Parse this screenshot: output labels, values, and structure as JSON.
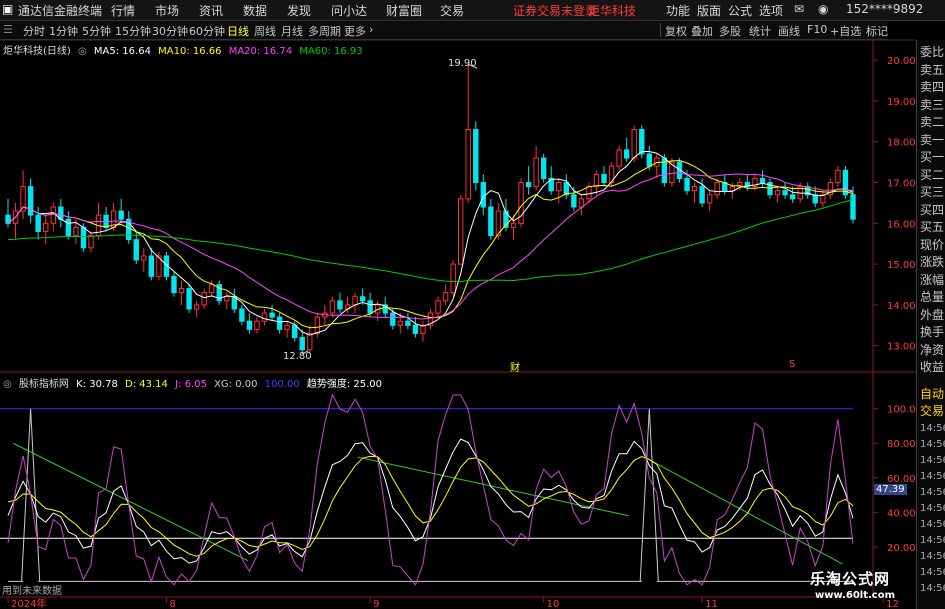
{
  "menubar": {
    "app_title": "通达信金融终端",
    "items": [
      "行情",
      "市场",
      "资讯",
      "数据",
      "发现",
      "问小达",
      "财富圈",
      "交易"
    ],
    "warning": "证券交易未登录",
    "stock_name": "炬华科技",
    "right_items": [
      "功能",
      "版面",
      "公式",
      "选项"
    ],
    "phone": "152****9892"
  },
  "toolbar": {
    "periods": [
      "分时",
      "1分钟",
      "5分钟",
      "15分钟",
      "30分钟",
      "60分钟",
      "日线",
      "周线",
      "月线",
      "多周期",
      "更多"
    ],
    "active_period": "日线",
    "right_buttons": [
      "复权",
      "叠加",
      "多股",
      "统计",
      "画线",
      "F10",
      "+自选",
      "标记"
    ]
  },
  "right_panel": {
    "labels": [
      "委比",
      "卖五",
      "卖四",
      "卖三",
      "卖二",
      "卖一",
      "买一",
      "买二",
      "买三",
      "买四",
      "买五",
      "现价",
      "涨跌",
      "涨幅",
      "总量",
      "外盘",
      "换手",
      "净资",
      "收益"
    ],
    "bottom_labels": [
      "自动",
      "交易"
    ],
    "times": [
      "14:56",
      "14:56",
      "14:56",
      "14:56",
      "14:56",
      "14:56",
      "14:56",
      "14:56",
      "14:56",
      "14:56",
      "14:56"
    ]
  },
  "main_chart": {
    "title": "炬华科技(日线)",
    "ma_labels": [
      {
        "text": "MA5: 16.64",
        "color": "#ffffff"
      },
      {
        "text": "MA10: 16.66",
        "color": "#ffff00"
      },
      {
        "text": "MA20: 16.74",
        "color": "#ff44ff"
      },
      {
        "text": "MA60: 16.93",
        "color": "#00cc00"
      }
    ],
    "high_label": "19.90",
    "low_label": "12.80",
    "marker_cai": "财",
    "marker_s": "S"
  },
  "sub_chart": {
    "title": "股标指标网",
    "values": [
      {
        "text": "K: 30.78",
        "color": "#ffffff"
      },
      {
        "text": "D: 43.14",
        "color": "#ffff00"
      },
      {
        "text": "J: 6.05",
        "color": "#ff44ff"
      },
      {
        "text": "XG: 0.00",
        "color": "#cccccc"
      },
      {
        "text": "100.00",
        "color": "#3344ff"
      }
    ],
    "trend_label": "趋势强度: 25.00",
    "current_value": "47.39",
    "future_note": "用到未来数据"
  },
  "watermark": {
    "line1": "乐淘公式网",
    "line2": "www.60lt.com"
  },
  "chart_data": [
    {
      "type": "candlestick",
      "title": "炬华科技(日线)",
      "y_axis_ticks": [
        13.0,
        14.0,
        15.0,
        16.0,
        17.0,
        18.0,
        19.0,
        20.0
      ],
      "ylim": [
        12.6,
        20.2
      ],
      "grid": false,
      "x_axis_ticks": [
        "2024年",
        "8",
        "9",
        "10",
        "11",
        "12"
      ],
      "ohlc": [
        [
          16.2,
          16.6,
          15.9,
          16.0
        ],
        [
          16.0,
          16.5,
          15.6,
          16.3
        ],
        [
          16.3,
          17.3,
          16.1,
          16.9
        ],
        [
          16.9,
          17.1,
          16.0,
          16.2
        ],
        [
          16.2,
          16.4,
          15.6,
          15.8
        ],
        [
          15.8,
          16.2,
          15.5,
          16.0
        ],
        [
          16.0,
          16.5,
          15.8,
          16.4
        ],
        [
          16.4,
          16.6,
          15.9,
          16.1
        ],
        [
          16.1,
          16.3,
          15.6,
          15.7
        ],
        [
          15.7,
          16.1,
          15.5,
          15.9
        ],
        [
          15.9,
          16.0,
          15.3,
          15.4
        ],
        [
          15.4,
          15.8,
          15.3,
          15.7
        ],
        [
          15.7,
          16.5,
          15.6,
          16.2
        ],
        [
          16.2,
          16.4,
          15.8,
          15.9
        ],
        [
          15.9,
          16.5,
          15.8,
          16.3
        ],
        [
          16.3,
          16.6,
          16.0,
          16.1
        ],
        [
          16.1,
          16.3,
          15.5,
          15.6
        ],
        [
          15.6,
          15.8,
          15.0,
          15.1
        ],
        [
          15.1,
          15.4,
          14.8,
          15.2
        ],
        [
          15.2,
          15.4,
          14.6,
          14.7
        ],
        [
          14.7,
          15.3,
          14.6,
          15.2
        ],
        [
          15.2,
          15.3,
          14.6,
          14.7
        ],
        [
          14.7,
          14.8,
          14.2,
          14.3
        ],
        [
          14.3,
          14.6,
          14.0,
          14.4
        ],
        [
          14.4,
          14.5,
          13.8,
          13.9
        ],
        [
          13.9,
          14.1,
          13.7,
          14.0
        ],
        [
          14.0,
          14.4,
          13.9,
          14.3
        ],
        [
          14.3,
          14.6,
          14.2,
          14.5
        ],
        [
          14.5,
          14.6,
          14.0,
          14.1
        ],
        [
          14.1,
          14.3,
          13.9,
          14.2
        ],
        [
          14.2,
          14.4,
          13.8,
          13.9
        ],
        [
          13.9,
          14.0,
          13.5,
          13.6
        ],
        [
          13.6,
          13.8,
          13.3,
          13.4
        ],
        [
          13.4,
          13.7,
          13.3,
          13.6
        ],
        [
          13.6,
          13.9,
          13.5,
          13.8
        ],
        [
          13.8,
          14.0,
          13.6,
          13.7
        ],
        [
          13.7,
          13.8,
          13.3,
          13.4
        ],
        [
          13.4,
          13.6,
          13.2,
          13.5
        ],
        [
          13.5,
          13.6,
          13.1,
          13.2
        ],
        [
          13.2,
          13.4,
          12.8,
          12.9
        ],
        [
          12.9,
          13.5,
          12.8,
          13.3
        ],
        [
          13.3,
          13.8,
          13.2,
          13.7
        ],
        [
          13.7,
          14.0,
          13.5,
          13.8
        ],
        [
          13.8,
          14.2,
          13.7,
          14.1
        ],
        [
          14.1,
          14.3,
          13.8,
          13.9
        ],
        [
          13.9,
          14.2,
          13.8,
          14.0
        ],
        [
          14.0,
          14.3,
          13.8,
          14.2
        ],
        [
          14.2,
          14.4,
          14.0,
          14.1
        ],
        [
          14.1,
          14.3,
          13.7,
          13.8
        ],
        [
          13.8,
          14.1,
          13.6,
          14.0
        ],
        [
          14.0,
          14.2,
          13.7,
          13.8
        ],
        [
          13.8,
          13.9,
          13.4,
          13.5
        ],
        [
          13.5,
          13.8,
          13.3,
          13.6
        ],
        [
          13.6,
          13.8,
          13.4,
          13.5
        ],
        [
          13.5,
          13.7,
          13.2,
          13.3
        ],
        [
          13.3,
          13.6,
          13.1,
          13.5
        ],
        [
          13.5,
          13.9,
          13.4,
          13.8
        ],
        [
          13.8,
          14.2,
          13.7,
          14.1
        ],
        [
          14.1,
          14.5,
          14.0,
          14.3
        ],
        [
          14.3,
          15.1,
          14.2,
          15.0
        ],
        [
          15.0,
          16.7,
          15.0,
          16.6
        ],
        [
          16.6,
          19.9,
          16.5,
          18.3
        ],
        [
          18.3,
          18.5,
          16.8,
          17.0
        ],
        [
          17.0,
          17.2,
          16.2,
          16.4
        ],
        [
          16.4,
          16.6,
          15.6,
          15.7
        ],
        [
          15.7,
          16.5,
          15.6,
          16.3
        ],
        [
          16.3,
          16.6,
          15.8,
          15.9
        ],
        [
          15.9,
          16.2,
          15.6,
          16.0
        ],
        [
          16.0,
          17.1,
          15.9,
          17.0
        ],
        [
          17.0,
          17.4,
          16.7,
          16.9
        ],
        [
          16.9,
          17.9,
          16.8,
          17.6
        ],
        [
          17.6,
          17.7,
          17.0,
          17.1
        ],
        [
          17.1,
          17.4,
          16.7,
          16.8
        ],
        [
          16.8,
          17.1,
          16.5,
          17.0
        ],
        [
          17.0,
          17.2,
          16.6,
          16.7
        ],
        [
          16.7,
          16.9,
          16.3,
          16.4
        ],
        [
          16.4,
          16.7,
          16.2,
          16.6
        ],
        [
          16.6,
          17.0,
          16.5,
          16.9
        ],
        [
          16.9,
          17.3,
          16.7,
          17.2
        ],
        [
          17.2,
          17.4,
          16.9,
          17.0
        ],
        [
          17.0,
          17.5,
          16.9,
          17.4
        ],
        [
          17.4,
          17.9,
          17.3,
          17.8
        ],
        [
          17.8,
          18.1,
          17.5,
          17.6
        ],
        [
          17.6,
          18.4,
          17.5,
          18.3
        ],
        [
          18.3,
          18.4,
          17.6,
          17.7
        ],
        [
          17.7,
          17.9,
          17.3,
          17.4
        ],
        [
          17.4,
          17.7,
          17.1,
          17.6
        ],
        [
          17.6,
          17.7,
          16.9,
          17.0
        ],
        [
          17.0,
          17.6,
          16.9,
          17.5
        ],
        [
          17.5,
          17.6,
          17.0,
          17.1
        ],
        [
          17.1,
          17.3,
          16.7,
          16.8
        ],
        [
          16.8,
          17.0,
          16.5,
          16.9
        ],
        [
          16.9,
          17.1,
          16.4,
          16.5
        ],
        [
          16.5,
          16.8,
          16.3,
          16.7
        ],
        [
          16.7,
          17.1,
          16.6,
          17.0
        ],
        [
          17.0,
          17.2,
          16.7,
          16.8
        ],
        [
          16.8,
          17.0,
          16.6,
          16.9
        ],
        [
          16.9,
          17.1,
          16.8,
          17.0
        ],
        [
          17.0,
          17.2,
          16.8,
          16.9
        ],
        [
          16.9,
          17.2,
          16.8,
          17.1
        ],
        [
          17.1,
          17.3,
          16.9,
          17.0
        ],
        [
          17.0,
          17.1,
          16.6,
          16.7
        ],
        [
          16.7,
          16.9,
          16.5,
          16.8
        ],
        [
          16.8,
          17.0,
          16.6,
          16.7
        ],
        [
          16.7,
          16.9,
          16.5,
          16.6
        ],
        [
          16.6,
          17.0,
          16.5,
          16.9
        ],
        [
          16.9,
          17.0,
          16.6,
          16.7
        ],
        [
          16.7,
          16.9,
          16.4,
          16.5
        ],
        [
          16.5,
          16.8,
          16.4,
          16.7
        ],
        [
          16.7,
          17.1,
          16.6,
          17.0
        ],
        [
          17.0,
          17.4,
          16.9,
          17.3
        ],
        [
          17.3,
          17.4,
          16.6,
          16.7
        ],
        [
          16.7,
          16.9,
          16.0,
          16.1
        ]
      ],
      "series": [
        {
          "name": "MA5",
          "color": "#ffffff",
          "role": "ma5"
        },
        {
          "name": "MA10",
          "color": "#ffff00",
          "role": "ma10"
        },
        {
          "name": "MA20",
          "color": "#ff44ff",
          "role": "ma20"
        },
        {
          "name": "MA60",
          "color": "#00cc00",
          "role": "ma60"
        }
      ]
    },
    {
      "type": "line",
      "title": "股标指标网",
      "y_axis_ticks": [
        20.0,
        40.0,
        60.0,
        80.0,
        100.0
      ],
      "ylim": [
        -5,
        112
      ],
      "grid": false,
      "reference_lines": [
        {
          "value": 100,
          "color": "#3333ff"
        },
        {
          "value": 25,
          "color": "#ffffff"
        }
      ],
      "series": [
        {
          "name": "K",
          "color": "#ffffff",
          "role": "k"
        },
        {
          "name": "D",
          "color": "#ffff00",
          "role": "d"
        },
        {
          "name": "J",
          "color": "#cc44cc",
          "role": "j"
        },
        {
          "name": "XG",
          "color": "#cccccc",
          "role": "xg"
        }
      ],
      "trend_lines": [
        {
          "color": "#33cc33",
          "from": [
            1,
            80
          ],
          "to": [
            46,
            12
          ]
        },
        {
          "color": "#33cc33",
          "from": [
            67,
            72
          ],
          "to": [
            119,
            38
          ]
        },
        {
          "color": "#33cc33",
          "from": [
            122,
            72
          ],
          "to": [
            160,
            10
          ]
        }
      ],
      "xg_spikes": [
        3,
        85
      ]
    }
  ]
}
